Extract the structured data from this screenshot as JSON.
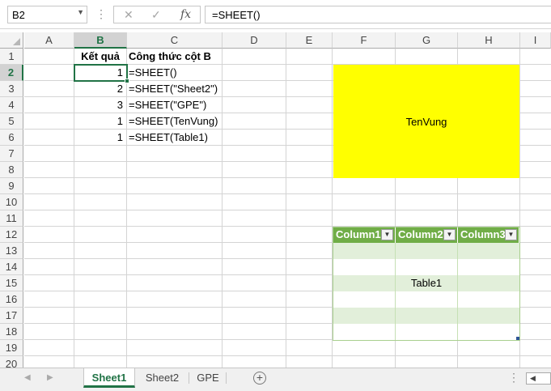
{
  "formula_bar": {
    "name_box": "B2",
    "name_box_dropdown_icon": "chevron-down-icon",
    "dots": "⋮",
    "cancel": "✕",
    "enter": "✓",
    "fx": "fx",
    "formula": "=SHEET()"
  },
  "columns": [
    "A",
    "B",
    "C",
    "D",
    "E",
    "F",
    "G",
    "H",
    "I"
  ],
  "rows": [
    "1",
    "2",
    "3",
    "4",
    "5",
    "6",
    "7",
    "8",
    "9",
    "10",
    "11",
    "12",
    "13",
    "14",
    "15",
    "16",
    "17",
    "18",
    "19",
    "20"
  ],
  "selected_cell": "B2",
  "cells": {
    "b1": "Kết quả",
    "c1": "Công thức cột B",
    "b2": "1",
    "c2": "=SHEET()",
    "b3": "2",
    "c3": "=SHEET(\"Sheet2\")",
    "b4": "3",
    "c4": "=SHEET(\"GPE\")",
    "b5": "1",
    "c5": "=SHEET(TenVung)",
    "b6": "1",
    "c6": "=SHEET(Table1)"
  },
  "shape": {
    "label": "TenVung",
    "color": "#ffff00"
  },
  "table": {
    "name": "Table1",
    "headers": [
      "Column1",
      "Column2",
      "Column3"
    ],
    "filter_icon": "dropdown-arrow-icon",
    "header_color": "#70ad47",
    "band_color": "#e2efda"
  },
  "sheet_tabs": [
    "Sheet1",
    "Sheet2",
    "GPE"
  ],
  "active_tab": "Sheet1",
  "add_sheet": "+",
  "tab_more": "⋮",
  "accent_color": "#217346"
}
